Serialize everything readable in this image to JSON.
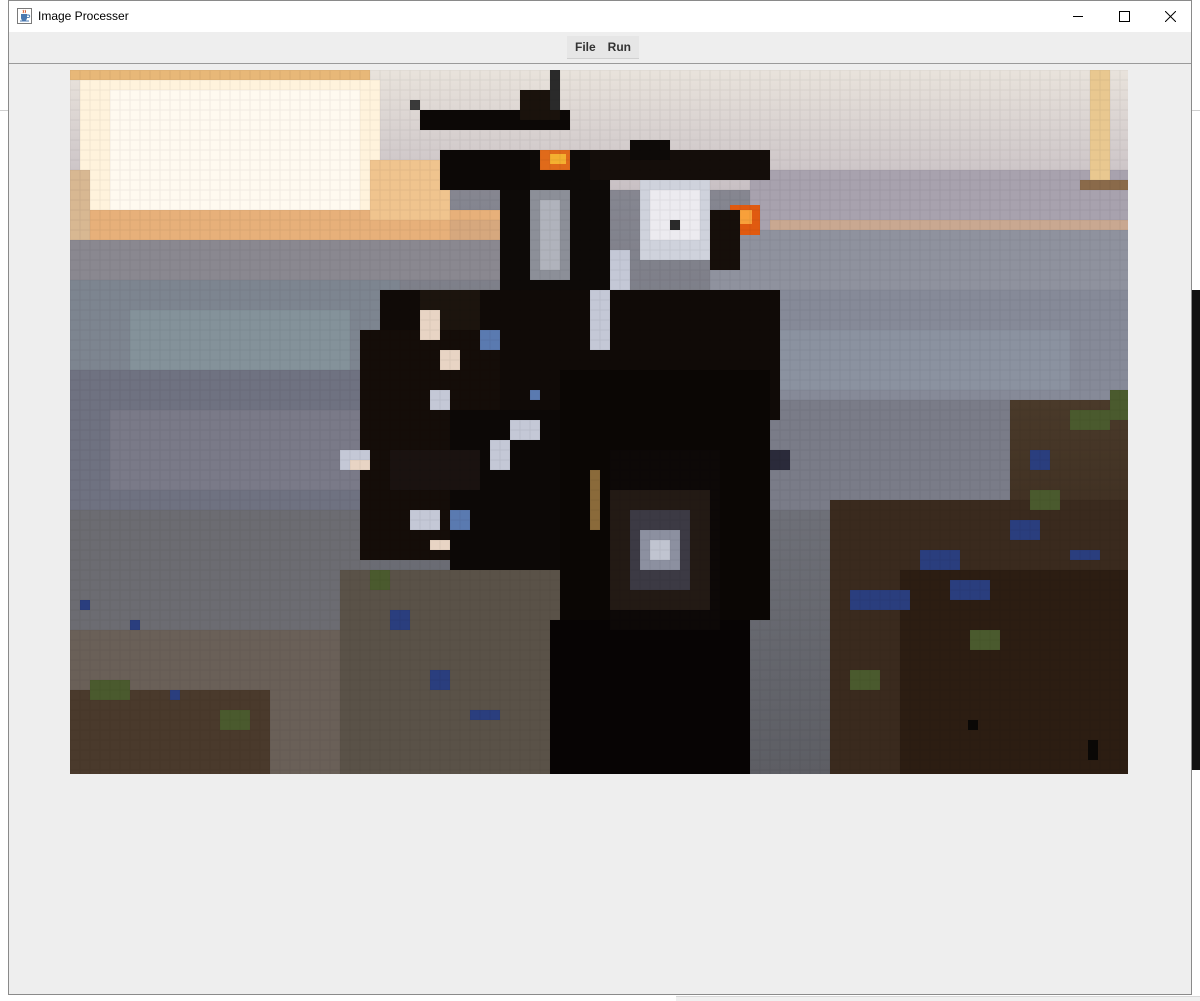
{
  "window": {
    "title": "Image Processer",
    "icon": "java-cup-icon"
  },
  "controls": {
    "minimize_icon": "minimize-icon",
    "maximize_icon": "maximize-icon",
    "close_icon": "close-icon"
  },
  "menu": {
    "items": [
      {
        "label": "File"
      },
      {
        "label": "Run"
      }
    ]
  },
  "image": {
    "subject": "pixelated-motorcycle-photo"
  },
  "colors": {
    "window_bg": "#eeeeee",
    "titlebar_bg": "#ffffff",
    "border": "#8a8a8a"
  }
}
